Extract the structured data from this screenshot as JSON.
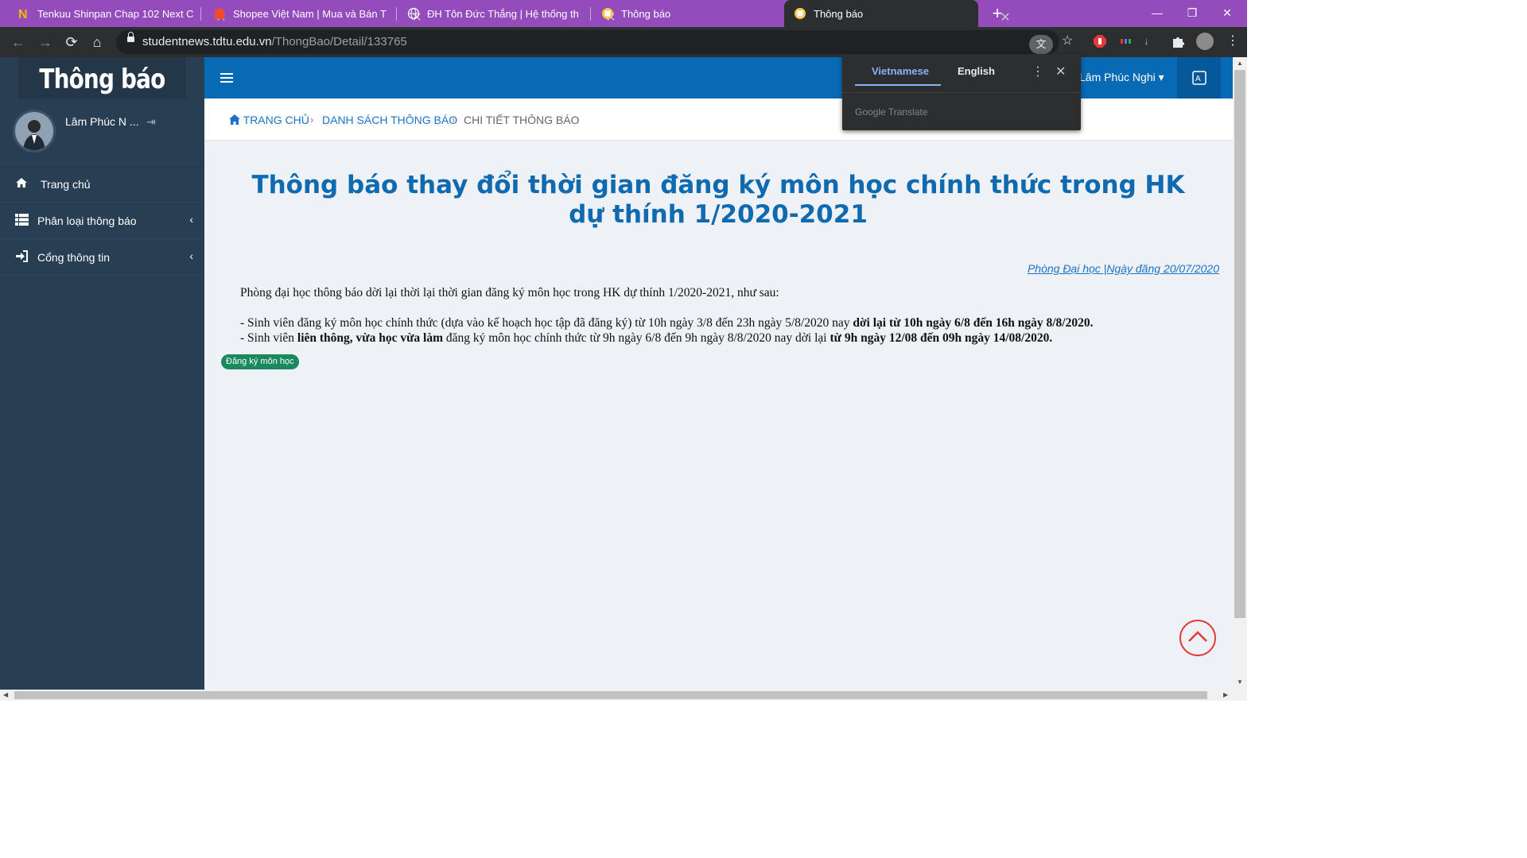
{
  "browser": {
    "tabs": [
      {
        "title": "Tenkuu Shinpan Chap 102 Next C",
        "icon": "n-logo-icon",
        "active": false
      },
      {
        "title": "Shopee Việt Nam | Mua và Bán T",
        "icon": "shopee-icon",
        "active": false
      },
      {
        "title": "ĐH Tôn Đức Thắng | Hệ thống th",
        "icon": "globe-icon",
        "active": false
      },
      {
        "title": "Thông báo",
        "icon": "notice-favicon-icon",
        "active": false
      },
      {
        "title": "Thông báo",
        "icon": "notice-favicon-icon",
        "active": true
      }
    ],
    "close_glyph": "✕",
    "new_tab_glyph": "+",
    "url_domain": "studentnews.tdtu.edu.vn",
    "url_path": "/ThongBao/Detail/133765",
    "tab_bar_color": "#944bbb",
    "toolbar_color": "#2d2e30"
  },
  "translate_popup": {
    "lang_source": "Vietnamese",
    "lang_target": "English",
    "brand": "Google Translate",
    "accent": "#8ab4f8"
  },
  "sidebar": {
    "brand": "Thông báo",
    "user_name": "Lâm Phúc N ...",
    "items": [
      {
        "label": "Trang chủ",
        "icon": "home-icon",
        "has_submenu": false
      },
      {
        "label": "Phân loại thông báo",
        "icon": "list-icon",
        "has_submenu": true
      },
      {
        "label": "Cổng thông tin",
        "icon": "sign-in-icon",
        "has_submenu": true
      }
    ],
    "color": "#283e52"
  },
  "header": {
    "user_name": "Lâm Phúc Nghi",
    "color": "#086ab5"
  },
  "breadcrumb": {
    "home": "TRANG CHỦ",
    "list": "DANH SÁCH THÔNG BÁO",
    "current": "CHI TIẾT THÔNG BÁO",
    "separator": "›"
  },
  "article": {
    "title": "Thông báo thay đổi thời gian đăng ký môn học chính thức trong HK dự thính 1/2020-2021",
    "meta": "Phòng Đại học  |Ngày đăng 20/07/2020",
    "intro": "Phòng đại học thông báo dời lại thời lại thời gian đăng ký môn học trong HK dự thính 1/2020-2021, như sau:",
    "line1_a": "- Sinh viên đăng ký môn học chính thức (dựa vào kế hoạch học tập đã đăng ký) từ 10h ngày 3/8 đến 23h ngày 5/8/2020 nay ",
    "line1_b": "dời lại từ 10h ngày 6/8 đến 16h ngày 8/8/2020.",
    "line2_a": "- Sinh viên  ",
    "line2_b": "liên thông, vừa học vừa làm",
    "line2_c": " đăng ký môn học chính thức từ 9h ngày 6/8 đến 9h ngày 8/8/2020 nay dời lại ",
    "line2_d": "từ 9h ngày 12/08 đến 09h ngày 14/08/2020.",
    "tag": "Đăng ký môn học",
    "title_color": "#0f6ab0",
    "tag_color": "#1a8a5d"
  }
}
